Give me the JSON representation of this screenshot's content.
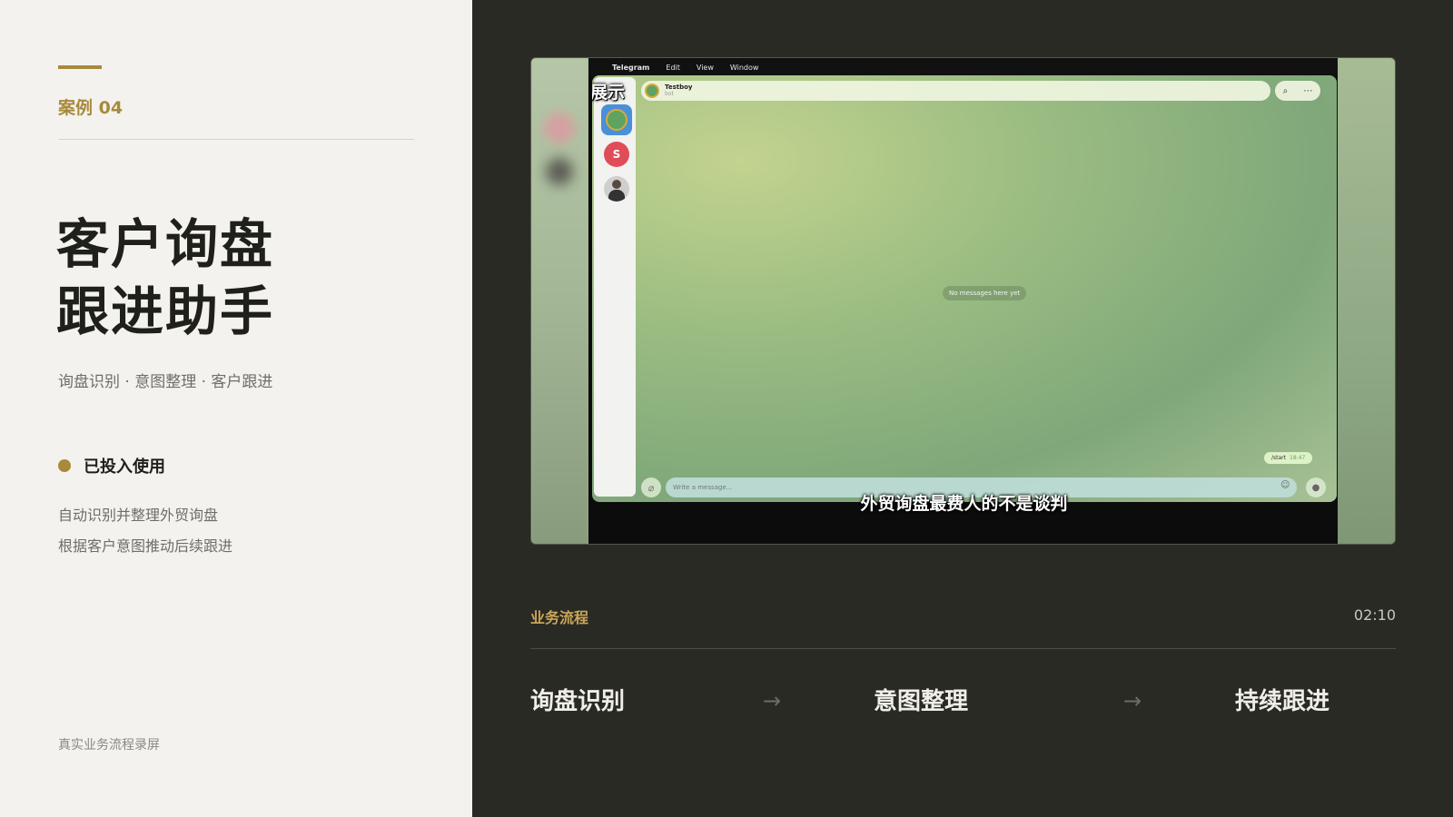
{
  "left": {
    "case_no": "案例 04",
    "title_line1": "客户询盘",
    "title_line2": "跟进助手",
    "subtitle": "询盘识别 · 意图整理 · 客户跟进",
    "status": "已投入使用",
    "desc_line1": "自动识别并整理外贸询盘",
    "desc_line2": "根据客户意图推动后续跟进",
    "footnote": "真实业务流程录屏"
  },
  "video": {
    "overlay_label": "案例展示",
    "caption": "外贸询盘最费人的不是谈判",
    "menubar": {
      "app": "Telegram",
      "items": [
        "Edit",
        "View",
        "Window"
      ]
    },
    "telegram": {
      "chat_name": "Testboy",
      "chat_sub": "bot",
      "sidebar_avatar_letter": "S",
      "empty_text": "No messages here yet",
      "message_text": "/start",
      "message_time": "18:47",
      "input_placeholder": "Write a message..."
    }
  },
  "flow": {
    "label": "业务流程",
    "time": "02:10",
    "steps": [
      "询盘识别",
      "意图整理",
      "持续跟进"
    ],
    "arrow": "→"
  },
  "colors": {
    "accent": "#a88a3c",
    "left_bg": "#f4f2ee",
    "right_bg": "#2a2a24",
    "flow_label": "#c9a65a"
  }
}
